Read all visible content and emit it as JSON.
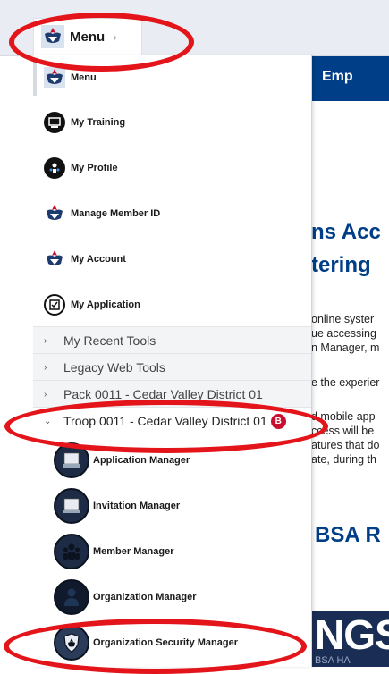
{
  "topbar": {
    "menu_label": "Menu",
    "chevron": "›"
  },
  "background": {
    "bluebar_text": "Emp",
    "heading1_line1": "ns Acc",
    "heading1_line2": "tering",
    "para1": [
      "online syster",
      "ue accessing",
      "n Manager, m"
    ],
    "para2": "e the experier",
    "para3": [
      "d mobile app",
      "ccess will be",
      "atures that do",
      "ate, during th"
    ],
    "heading2": "BSA R",
    "banner_big": "NGS",
    "banner_small": "BSA HA"
  },
  "drawer": {
    "top_items": [
      {
        "label": "Menu",
        "icon": "bsa-logo-icon"
      },
      {
        "label": "My Training",
        "icon": "training-icon"
      },
      {
        "label": "My Profile",
        "icon": "profile-icon"
      },
      {
        "label": "Manage Member ID",
        "icon": "bsa-logo-icon"
      },
      {
        "label": "My Account",
        "icon": "bsa-logo-icon"
      },
      {
        "label": "My Application",
        "icon": "clipboard-check-icon"
      }
    ],
    "groups": [
      {
        "label": "My Recent Tools",
        "caret": "›"
      },
      {
        "label": "Legacy Web Tools",
        "caret": "›"
      },
      {
        "label": "Pack 0011 - Cedar Valley District 01",
        "caret": "›"
      },
      {
        "label": "Troop 0011 - Cedar Valley District 01",
        "caret": "⌄",
        "badge": "B"
      }
    ],
    "sub_items": [
      {
        "label": "Application Manager",
        "icon": "document-stack-icon"
      },
      {
        "label": "Invitation Manager",
        "icon": "document-stack-icon"
      },
      {
        "label": "Member Manager",
        "icon": "people-icon"
      },
      {
        "label": "Organization Manager",
        "icon": "person-icon"
      },
      {
        "label": "Organization Security Manager",
        "icon": "shield-icon"
      }
    ]
  },
  "colors": {
    "highlight": "#e3141a",
    "badge": "#c8102e",
    "brand_blue": "#003f87"
  }
}
